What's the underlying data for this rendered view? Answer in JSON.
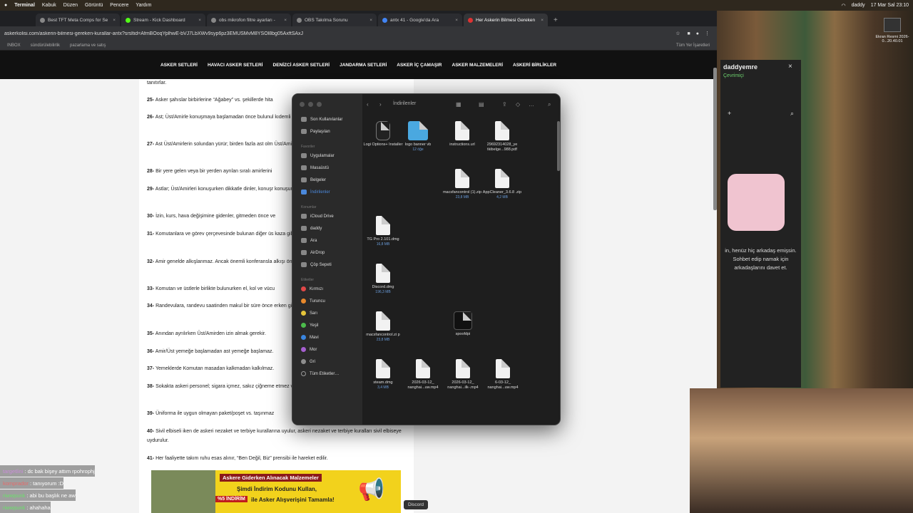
{
  "menubar": {
    "app": "Terminal",
    "items": [
      "Kabuk",
      "Düzen",
      "Görüntü",
      "Pencere",
      "Yardım"
    ],
    "user": "daddy",
    "datetime": "17 Mar Sal 23:10"
  },
  "browser": {
    "tabs": [
      "Best TFT Meta Comps for Se",
      "Stream - Kick Dashboard",
      "obs mikrofon filtre ayarları -",
      "OBS Takılma Sorunu",
      "antx 41 - Google'da Ara",
      "Her Askerin Bilmesi Gereken"
    ],
    "url": "askerkolisi.com/askerin-bilmesi-gereken-kurallar-antx?srsltid=AfmBOoqYplhwE-bVJ7LbXWv9syp6pz3EMUSMvM8YSOl8bg05AxftSAxJ",
    "bookmarks": [
      "INBOX",
      "sündürülebilirlik",
      "pazarlama ve satış",
      "Tüm Yer İşaretleri"
    ]
  },
  "site": {
    "nav": [
      "ASKER SETLERİ",
      "HAVACI ASKER SETLERİ",
      "DENİZCİ ASKER SETLERİ",
      "JANDARMA SETLERİ",
      "ASKER İÇ ÇAMAŞIR",
      "ASKER MALZEMELERİ",
      "ASKERİ BİRLİKLER"
    ],
    "intro": "tanıtırlar.",
    "paras": [
      {
        "num": "25-",
        "text": "Asker şahıslar birbirlerine “Ağabey” vs. şekillerde hita"
      },
      {
        "num": "26-",
        "text": "Ast; Üst/Amirle konuşmaya başlamadan önce bulunul kıdemli biri varsa ondan müsaade ister."
      },
      {
        "num": "27-",
        "text": "Ast Üst/Amirlerin solundan yürür; birden fazla ast olm Üst/Amirin sağ ve solundan yürürler."
      },
      {
        "num": "28-",
        "text": "Bir yere gelen veya bir yerden ayrılan sıralı amirlerini"
      },
      {
        "num": "29-",
        "text": "Astlar; Üst/Amirleri konuşurken dikkatle dinler, konuşr konuşur, bir seferde bir kişi konuşurlar."
      },
      {
        "num": "30-",
        "text": "İzin, kurs, hava değişimine gidenler, gitmeden önce ve"
      },
      {
        "num": "31-",
        "text": "Komutanlara ve görev çerçevesinde bulunan diğer üs kaza gibi olaylar zamanında haber verilmeli ve uygun ted"
      },
      {
        "num": "32-",
        "text": "Amir genelde alkışlanmaz. Ancak önemli konferansla alkışı önce büyüklerin başlatması, astlarında buna iştiraki"
      },
      {
        "num": "33-",
        "text": "Komutan ve üstlerle birlikte bulunurken el, kol ve vücu"
      },
      {
        "num": "34-",
        "text": "Randevulara, randevu saatinden makul bir süre önce erken gitmekte uygun değildir."
      },
      {
        "num": "35-",
        "text": "Anından ayrılırken Üst/Amirden izin almak gerekir."
      },
      {
        "num": "36-",
        "text": "Amir/Üst yemeğe başlamadan ast yemeğe başlamaz."
      },
      {
        "num": "37-",
        "text": "Yemeklerde Komutan masadan kalkmadan kalkılmaz."
      },
      {
        "num": "38-",
        "text": "Sokakta askeri personel; sigara içmez, sakız çiğneme etmez ve şakalaşmaz vs. ciddiyete uymayan benzer hare"
      },
      {
        "num": "39-",
        "text": "Üniforma ile uygun olmayan paket/poşet vs. taşınmaz"
      },
      {
        "num": "40-",
        "text": "Sivil elbiseli iken de askeri nezaket ve terbiye kurallarına uyulur, askeri nezaket ve terbiye kuralları sivil elbiseye uydurulur."
      },
      {
        "num": "41-",
        "text": "Her faaliyette takım ruhu esas alınır, “Ben Değil, Biz” prensibi ile hareket edilir."
      }
    ]
  },
  "finder": {
    "title": "İndirilenler",
    "fav_header": "Favoriler",
    "favorites": [
      "Son Kullanılanlar",
      "Paylaşılan",
      "Uygulamalar",
      "Masaüstü",
      "Belgeler",
      "İndirilenler"
    ],
    "loc_header": "Konumlar",
    "locations": [
      "iCloud Drive",
      "daddy",
      "Ara",
      "AirDrop",
      "Çöp Sepeti"
    ],
    "tag_header": "Etiketler",
    "tags": [
      {
        "name": "Kırmızı",
        "color": "#e04848"
      },
      {
        "name": "Turuncu",
        "color": "#e8892c"
      },
      {
        "name": "Sarı",
        "color": "#e4c43a"
      },
      {
        "name": "Yeşil",
        "color": "#4cbc4c"
      },
      {
        "name": "Mavi",
        "color": "#3a86e0"
      },
      {
        "name": "Mor",
        "color": "#a55fd0"
      },
      {
        "name": "Gri",
        "color": "#8e8e8e"
      },
      {
        "name": "Tüm Etiketler…",
        "color": ""
      }
    ],
    "files": [
      {
        "name": "Logi Options+ Installer",
        "size": ""
      },
      {
        "name": "logo banner vb",
        "size": "12 öğe"
      },
      {
        "name": "instructions.url",
        "size": ""
      },
      {
        "name": "29692314028_ye tkibelge...988.pdf",
        "size": ""
      },
      {
        "name": "macsfancontrol (1).zip",
        "size": "23,8 MB"
      },
      {
        "name": "AppCleaner_3.6.8 .zip",
        "size": "4,2 MB"
      },
      {
        "name": "TG Pro 2.101.dmg",
        "size": "16,8 MB"
      },
      {
        "name": "Discord.dmg",
        "size": "196,3 MB"
      },
      {
        "name": "macsfancontrol.zi p",
        "size": "23,8 MB"
      },
      {
        "name": "spoofdpi",
        "size": ""
      },
      {
        "name": "steam.dmg",
        "size": "3,4 MB"
      },
      {
        "name": "2026-03-12_ nanghai...uw.mp4",
        "size": ""
      },
      {
        "name": "2026-03-12_ nanghai...ilk-.mp4",
        "size": ""
      },
      {
        "name": "6-03-12_ nanghai...uw.mp4",
        "size": ""
      }
    ]
  },
  "discord_panel": {
    "username": "daddyemre",
    "status": "Çevrimiçi",
    "message": "in, henüz hiç arkadaş emişsin. Sohbet edip namak için arkadaşlarını davet et."
  },
  "screenshot_thumb": {
    "label": "Ekran Resmi 2026-0...20.40.01"
  },
  "chat": [
    {
      "user": "targetlini",
      "text": "dc bak bişey attım rpohrophj",
      "color": "#c88cd8"
    },
    {
      "user": "komprador",
      "text": "tanıyorum :D",
      "color": "#e66b6b"
    },
    {
      "user": "riwwpunk",
      "text": "abi bu başlık ne aw",
      "color": "#6be06b"
    },
    {
      "user": "riwwpunk",
      "text": "ahahaha",
      "color": "#6be06b"
    }
  ],
  "ad": {
    "title": "Askere Giderken Alınacak Malzemeler",
    "line1": "Şimdi İndirim Kodunu Kullan,",
    "badge": "%5 İNDİRİM",
    "line2": "ile Asker Alışverişini Tamamla!"
  },
  "dock_tooltip": "Discord"
}
